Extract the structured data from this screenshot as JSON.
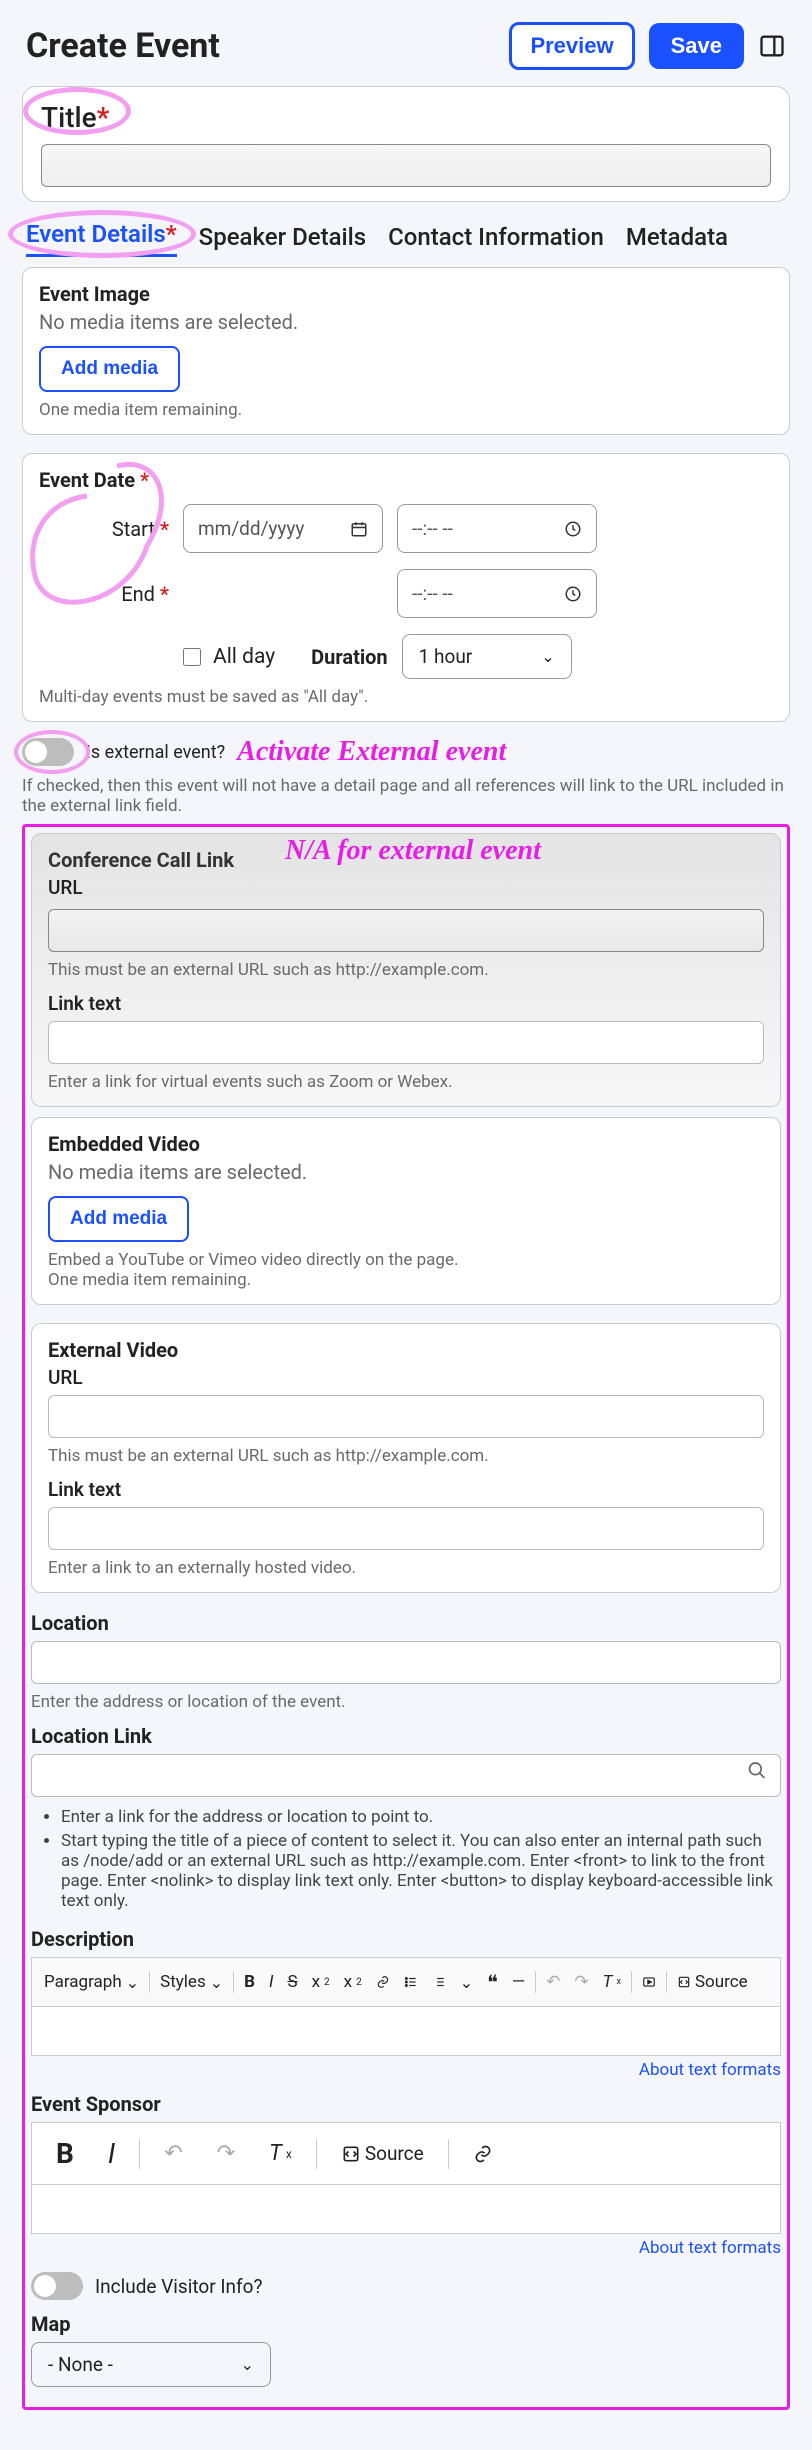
{
  "header": {
    "title": "Create Event",
    "preview": "Preview",
    "save": "Save"
  },
  "title_section": {
    "label": "Title"
  },
  "tabs": [
    {
      "label": "Event Details",
      "active": true,
      "required": true
    },
    {
      "label": "Speaker Details",
      "active": false,
      "required": false
    },
    {
      "label": "Contact Information",
      "active": false,
      "required": false
    },
    {
      "label": "Metadata",
      "active": false,
      "required": false
    }
  ],
  "event_image": {
    "label": "Event Image",
    "empty": "No media items are selected.",
    "add": "Add media",
    "remaining": "One media item remaining."
  },
  "event_date": {
    "label": "Event Date",
    "start": "Start",
    "end": "End",
    "date_placeholder": "mm/dd/yyyy",
    "time_placeholder": "--:-- --",
    "allday": "All day",
    "duration_label": "Duration",
    "duration_value": "1 hour",
    "multi_day_help": "Multi-day events must be saved as \"All day\"."
  },
  "external_toggle": {
    "label": "Is external event?",
    "help": "If checked, then this event will not have a detail page and all references will link to the URL included in the external link field."
  },
  "annotations": {
    "activate": "Activate External event",
    "na": "N/A for external event"
  },
  "conf_call": {
    "label": "Conference Call Link",
    "url": "URL",
    "url_help": "This must be an external URL such as http://example.com.",
    "link_text": "Link text",
    "link_help": "Enter a link for virtual events such as Zoom or Webex."
  },
  "embedded_video": {
    "label": "Embedded Video",
    "empty": "No media items are selected.",
    "add": "Add media",
    "help1": "Embed a YouTube or Vimeo video directly on the page.",
    "help2": "One media item remaining."
  },
  "external_video": {
    "label": "External Video",
    "url": "URL",
    "url_help": "This must be an external URL such as http://example.com.",
    "link_text": "Link text",
    "link_help": "Enter a link to an externally hosted video."
  },
  "location": {
    "label": "Location",
    "help": "Enter the address or location of the event."
  },
  "location_link": {
    "label": "Location Link",
    "bullets": [
      "Enter a link for the address or location to point to.",
      "Start typing the title of a piece of content to select it. You can also enter an internal path such as /node/add or an external URL such as http://example.com. Enter <front> to link to the front page. Enter <nolink> to display link text only. Enter <button> to display keyboard-accessible link text only."
    ]
  },
  "description": {
    "label": "Description",
    "paragraph": "Paragraph",
    "styles": "Styles",
    "source": "Source",
    "about": "About text formats"
  },
  "sponsor": {
    "label": "Event Sponsor",
    "source": "Source",
    "about": "About text formats"
  },
  "visitor": {
    "label": "Include Visitor Info?"
  },
  "map": {
    "label": "Map",
    "value": "- None -"
  }
}
